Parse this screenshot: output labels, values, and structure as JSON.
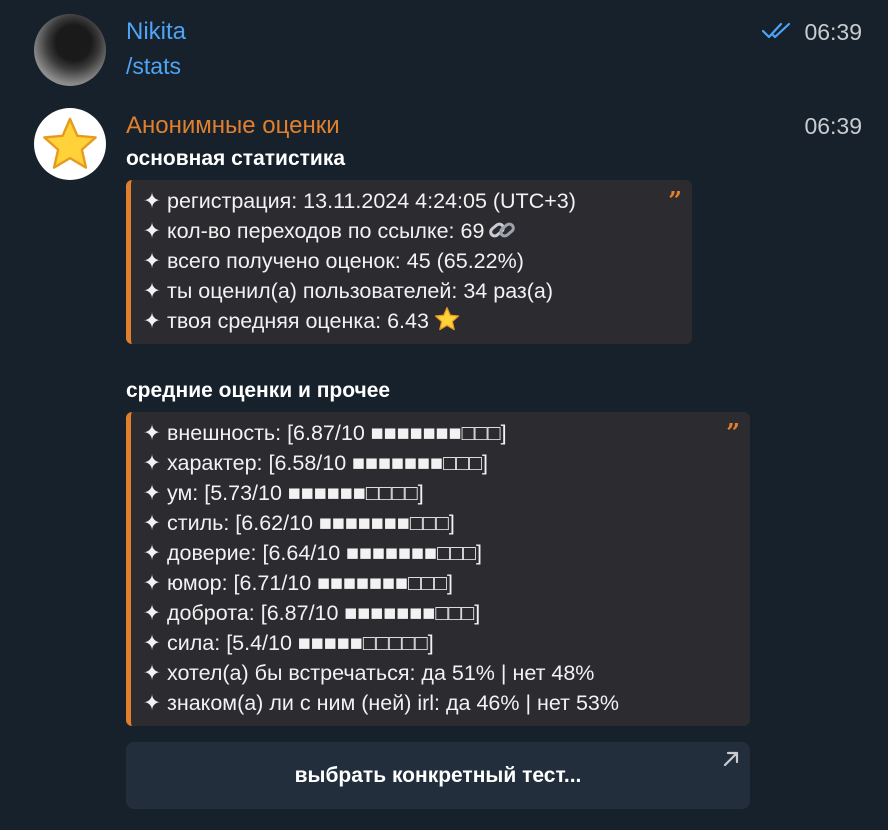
{
  "messages": [
    {
      "sender": "Nikita",
      "sender_color": "#4ea4f6",
      "time": "06:39",
      "status_icon": "double-check-icon",
      "text": "/stats"
    },
    {
      "sender": "Анонимные оценки",
      "sender_color": "#e0802e",
      "time": "06:39",
      "avatar_icon": "star-icon",
      "section1_title": "основная статистика",
      "section1_lines": [
        "✦ регистрация: 13.11.2024 4:24:05 (UTC+3)",
        "✦ кол-во переходов по ссылке: 69",
        "✦ всего получено оценок: 45 (65.22%)",
        "✦ ты оценил(а) пользователей: 34 раз(а)",
        "✦ твоя средняя оценка: 6.43"
      ],
      "section2_title": "средние оценки и прочее",
      "section2_lines": [
        "✦ внешность: [6.87/10 ■■■■■■■□□□]",
        "✦ характер: [6.58/10 ■■■■■■■□□□]",
        "✦ ум: [5.73/10 ■■■■■■□□□□]",
        "✦ стиль: [6.62/10 ■■■■■■■□□□]",
        "✦ доверие: [6.64/10 ■■■■■■■□□□]",
        "✦ юмор: [6.71/10 ■■■■■■■□□□]",
        "✦ доброта: [6.87/10 ■■■■■■■□□□]",
        "✦ сила: [5.4/10 ■■■■■□□□□□]",
        "✦ хотел(а) бы встречаться: да 51% | нет 48%",
        "✦ знаком(а) ли с ним (ней) irl: да 46% | нет 53%"
      ],
      "quote_mark": "”",
      "button_label": "выбрать конкретный тест..."
    }
  ],
  "colors": {
    "background": "#17212b",
    "accent_orange": "#e0802e",
    "accent_blue": "#4ea4f6",
    "quote_bg": "#2b2b30",
    "button_bg": "#232e3c"
  }
}
